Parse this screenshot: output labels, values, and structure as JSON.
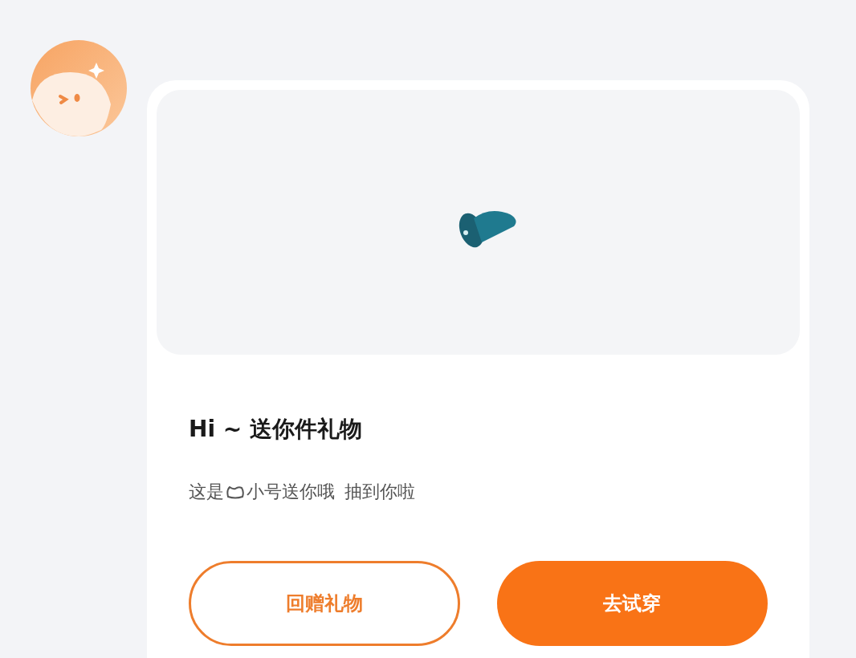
{
  "message": {
    "title": "Hi ~ 送你件礼物",
    "subtitle_before": "这是",
    "subtitle_after": "小号送你哦",
    "subtitle_extra": "抽到你啦"
  },
  "buttons": [
    {
      "label": "回赠礼物",
      "kind": "outline"
    },
    {
      "label": "去试穿",
      "kind": "filled"
    }
  ]
}
